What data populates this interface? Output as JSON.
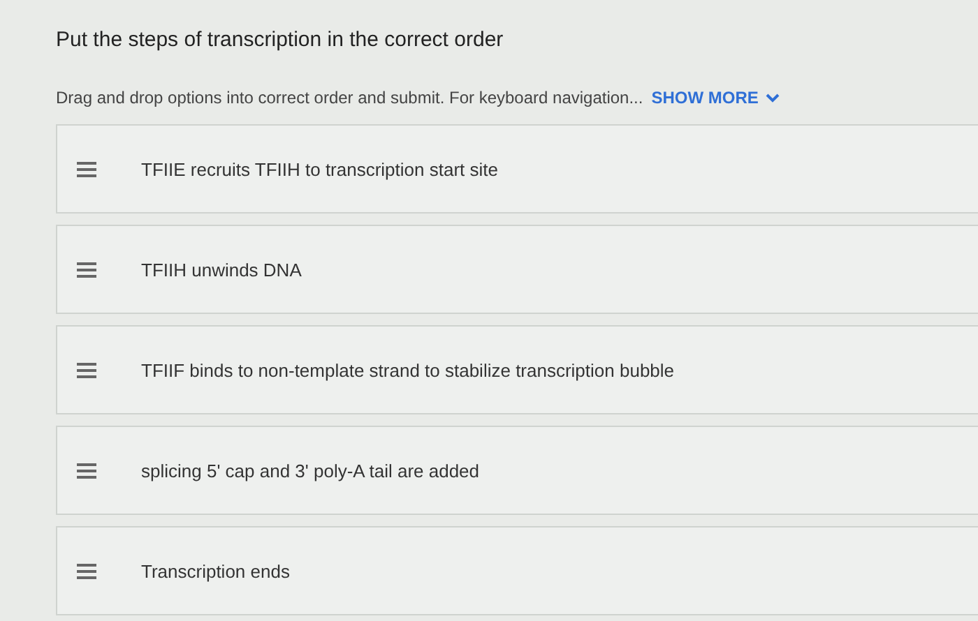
{
  "title": "Put the steps of transcription in the correct order",
  "instructions": {
    "text": "Drag and drop options into correct order and submit. For keyboard navigation...",
    "link": "SHOW MORE"
  },
  "options": [
    {
      "label": "TFIIE recruits TFIIH to transcription start site"
    },
    {
      "label": "TFIIH unwinds DNA"
    },
    {
      "label": "TFIIF binds to non-template strand to stabilize transcription bubble"
    },
    {
      "label": "splicing 5' cap and 3' poly-A tail are added"
    },
    {
      "label": "Transcription ends"
    }
  ]
}
